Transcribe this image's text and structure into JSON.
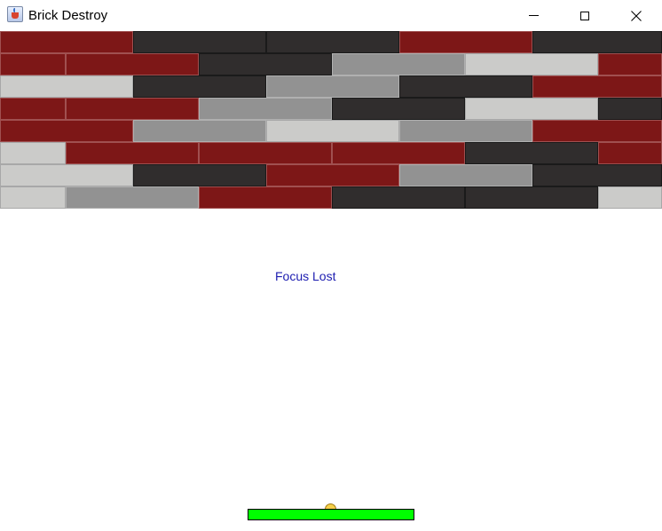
{
  "window": {
    "title": "Brick Destroy",
    "icon": "java-cup-icon",
    "controls": [
      "minimize-icon",
      "maximize-icon",
      "close-icon"
    ]
  },
  "game": {
    "status_message": "Focus Lost",
    "colors": {
      "clay": "#7d1717",
      "clay_border": "#a05050",
      "steel": "#929292",
      "steel_border": "#b0b0b0",
      "cement": "#cbcbc9",
      "cement_border": "#a8a8a8",
      "dark": "#302d2d",
      "dark_border": "#1a1a1a",
      "paddle": "#00ff00",
      "ball": "#f5d14a"
    },
    "brick_rows": [
      [
        "clay",
        "dark",
        "dark",
        "clay",
        "dark"
      ],
      [
        "clay",
        "clay",
        "dark",
        "steel",
        "cement",
        "clay"
      ],
      [
        "cement",
        "dark",
        "steel",
        "dark",
        "clay"
      ],
      [
        "clay",
        "clay",
        "steel",
        "dark",
        "cement",
        "dark"
      ],
      [
        "clay",
        "steel",
        "cement",
        "steel",
        "clay"
      ],
      [
        "cement",
        "clay",
        "clay",
        "clay",
        "dark",
        "clay"
      ],
      [
        "cement",
        "dark",
        "clay",
        "steel",
        "dark"
      ],
      [
        "cement",
        "steel",
        "clay",
        "dark",
        "dark",
        "cement"
      ]
    ]
  }
}
